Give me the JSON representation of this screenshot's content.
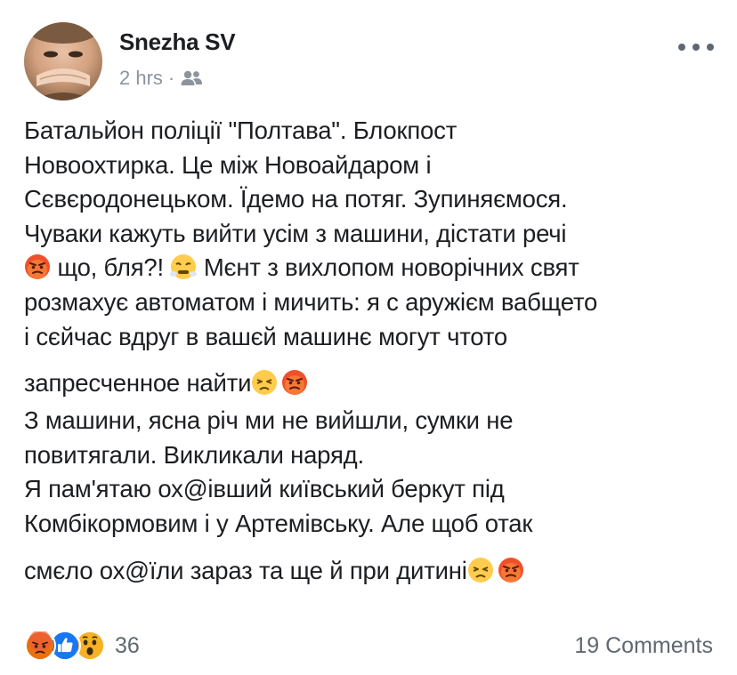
{
  "post": {
    "author": "Snezha SV",
    "time": "2 hrs",
    "separator": "·",
    "audience_icon": "friends-icon",
    "more_icon": "more-options-icon",
    "lines": [
      "Батальйон поліції \"Полтава\". Блокпост",
      "Новоохтирка. Це між Новоайдаром і",
      "Сєвєродонецьком. Їдемо на потяг. Зупиняємося.",
      "Чуваки кажуть вийти усім з машини, дістати речі",
      "що, бля?!",
      "Мєнт з вихлопом новорічних свят",
      "розмахує автоматом і мичить: я с аружієм вабщето",
      "і сєйчас вдруг в вашєй машинє могут чтото",
      "запресченное найти",
      "З машини, ясна річ ми не вийшли, сумки не",
      "повитягали. Викликали наряд.",
      "Я пам'ятаю ох@івший київський беркут під",
      "Комбікормовим і у Артемівську. Але щоб отак",
      "смєло ох@їли зараз та ще й при дитині"
    ]
  },
  "footer": {
    "reactions": [
      "angry",
      "like",
      "wow"
    ],
    "reaction_count": "36",
    "comments": "19 Comments"
  },
  "colors": {
    "text": "#1c1e21",
    "secondary": "#8d949e",
    "angry": "#e9710f",
    "like": "#1877f2",
    "wow": "#f7b125"
  }
}
